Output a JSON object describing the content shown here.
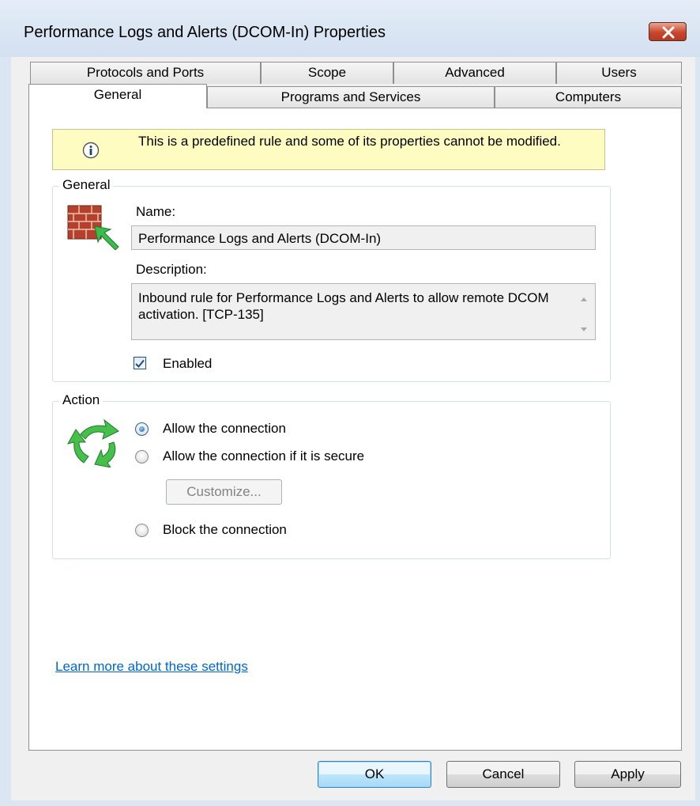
{
  "window": {
    "title": "Performance Logs and Alerts (DCOM-In) Properties"
  },
  "tabs": {
    "row_back": [
      "Protocols and Ports",
      "Scope",
      "Advanced",
      "Users"
    ],
    "row_front": [
      "General",
      "Programs and Services",
      "Computers"
    ],
    "active": "General"
  },
  "info": {
    "message": "This is a predefined rule and some of its properties cannot be modified."
  },
  "general": {
    "legend": "General",
    "name_label": "Name:",
    "name_value": "Performance Logs and Alerts (DCOM-In)",
    "description_label": "Description:",
    "description_value": "Inbound rule for Performance Logs and Alerts to allow remote DCOM activation. [TCP-135]",
    "enabled_label": "Enabled",
    "enabled": true
  },
  "action": {
    "legend": "Action",
    "options": [
      {
        "label": "Allow the connection",
        "checked": true
      },
      {
        "label": "Allow the connection if it is secure",
        "checked": false
      },
      {
        "label": "Block the connection",
        "checked": false
      }
    ],
    "customize_label": "Customize..."
  },
  "link": {
    "learn_more": "Learn more about these settings"
  },
  "buttons": {
    "ok": "OK",
    "cancel": "Cancel",
    "apply": "Apply"
  },
  "icons": {
    "close": "close-icon",
    "info": "info-icon",
    "firewall": "firewall-icon",
    "action": "action-arrows-icon"
  },
  "colors": {
    "info_bg": "#fefcc0",
    "link": "#0066cc",
    "close_button": "#c9462c",
    "title_bg": "#dbe6f3"
  }
}
